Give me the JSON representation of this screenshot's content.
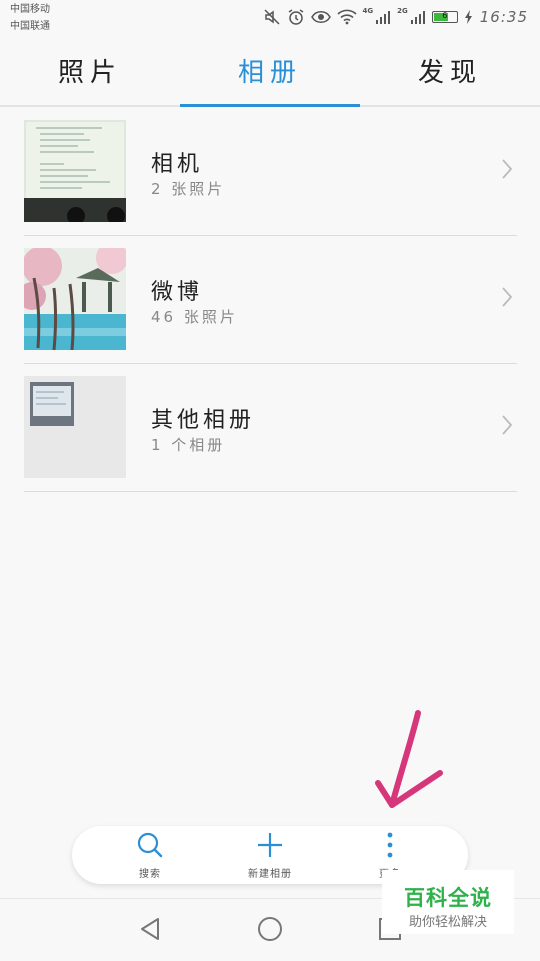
{
  "status_bar": {
    "carrier_1": "中国移动",
    "carrier_2": "中国联通",
    "net_1": "4G",
    "net_2": "2G",
    "battery_level": "6",
    "time": "16:35",
    "icons": [
      "mute-icon",
      "alarm-icon",
      "eye-icon",
      "wifi-icon",
      "signal-icon",
      "signal-icon",
      "battery-icon",
      "charging-icon"
    ]
  },
  "tabs": [
    {
      "label": "照片",
      "active": false
    },
    {
      "label": "相册",
      "active": true
    },
    {
      "label": "发现",
      "active": false
    }
  ],
  "albums": [
    {
      "name": "相机",
      "count": "2 张照片"
    },
    {
      "name": "微博",
      "count": "46 张照片"
    },
    {
      "name": "其他相册",
      "count": "1 个相册"
    }
  ],
  "action_bar": {
    "search_label": "搜索",
    "new_album_label": "新建相册",
    "more_label": "更多"
  },
  "watermark": {
    "title": "百科全说",
    "subtitle": "助你轻松解决"
  },
  "colors": {
    "accent": "#2b8fd6",
    "annotation": "#d6367a",
    "watermark": "#2fb24a"
  }
}
